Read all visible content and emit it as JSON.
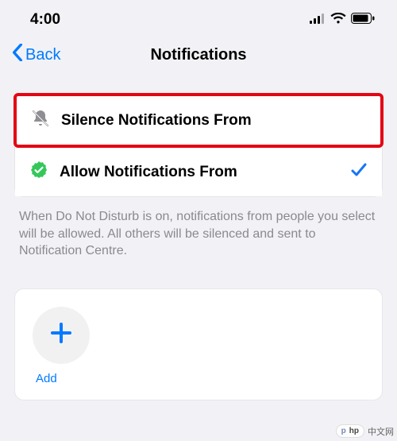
{
  "status": {
    "time": "4:00"
  },
  "nav": {
    "back_label": "Back",
    "title": "Notifications"
  },
  "options": {
    "silence": {
      "label": "Silence Notifications From",
      "selected": false
    },
    "allow": {
      "label": "Allow Notifications From",
      "selected": true
    }
  },
  "footer_text": "When Do Not Disturb is on, notifications from people you select will be allowed. All others will be silenced and sent to Notification Centre.",
  "add": {
    "label": "Add"
  },
  "watermark": {
    "php": "php",
    "cn": "中文网"
  },
  "colors": {
    "accent": "#007aff",
    "highlight": "#e30614",
    "verify": "#34c759"
  }
}
